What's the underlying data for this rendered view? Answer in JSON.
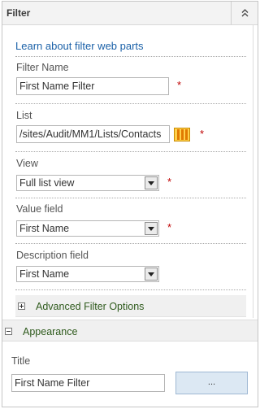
{
  "panel": {
    "title": "Filter",
    "collapse_icon": "double-chevron-up-icon"
  },
  "learn_link": "Learn about filter web parts",
  "filter_name": {
    "label": "Filter Name",
    "value": "First Name Filter",
    "required_mark": "*"
  },
  "list": {
    "label": "List",
    "value": "/sites/Audit/MM1/Lists/Contacts",
    "browse_icon": "list-icon",
    "required_mark": "*"
  },
  "view": {
    "label": "View",
    "selected": "Full list view",
    "required_mark": "*"
  },
  "value_field": {
    "label": "Value field",
    "selected": "First Name",
    "required_mark": "*"
  },
  "description_field": {
    "label": "Description field",
    "selected": "First Name"
  },
  "advanced": {
    "label": "Advanced Filter Options",
    "expander_icon": "plus-icon"
  },
  "appearance": {
    "label": "Appearance",
    "expander_icon": "minus-icon"
  },
  "title_field": {
    "label": "Title",
    "value": "First Name Filter",
    "browse_button": "..."
  },
  "colors": {
    "link": "#1b61a8",
    "section_label": "#2e5a1c",
    "required": "#bf0000",
    "button_bg": "#dce8f3"
  }
}
